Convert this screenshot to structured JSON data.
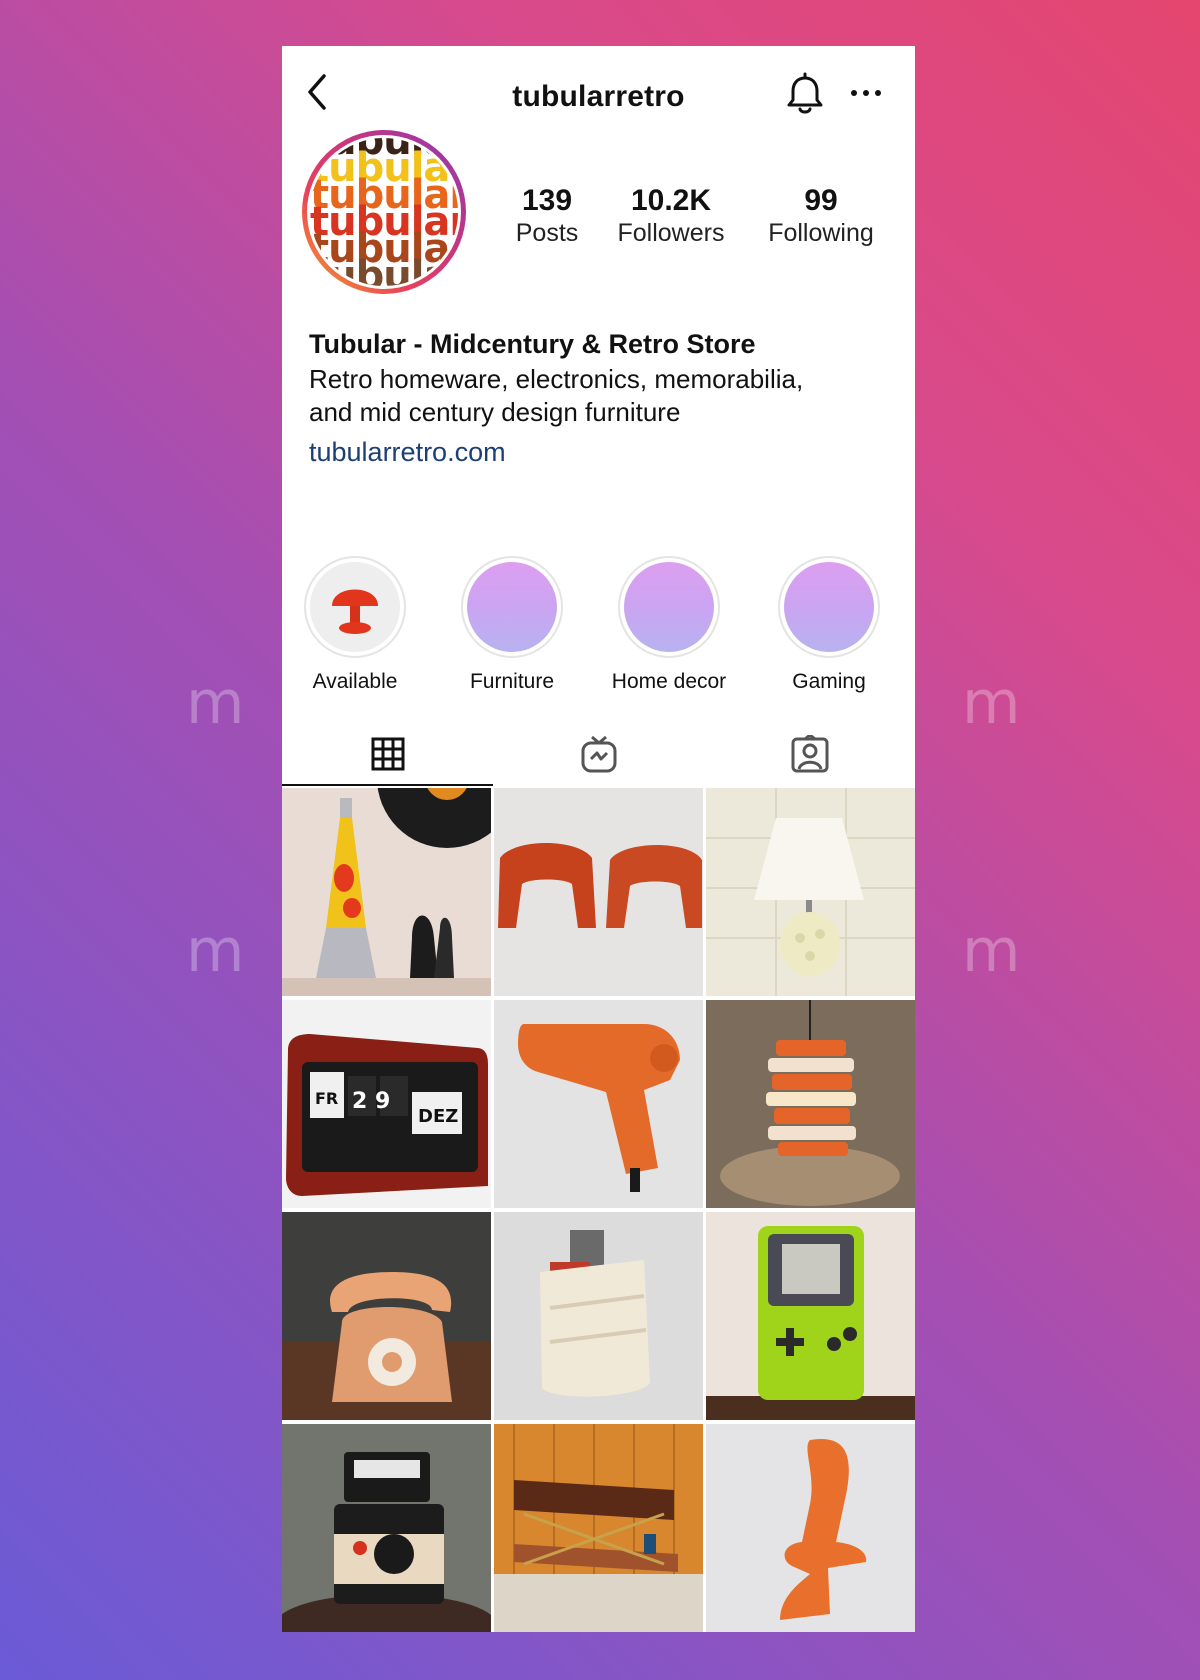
{
  "profile": {
    "username": "tubularretro",
    "avatar_words": [
      "tubular",
      "tubular",
      "tubular",
      "tubular",
      "tubular",
      "tubular",
      "tubular"
    ],
    "stats": [
      {
        "value": "139",
        "label": "Posts"
      },
      {
        "value": "10.2K",
        "label": "Followers"
      },
      {
        "value": "99",
        "label": "Following"
      }
    ],
    "display_name": "Tubular - Midcentury & Retro Store",
    "bio_line1": "Retro homeware, electronics, memorabilia,",
    "bio_line2": "and mid century design furniture",
    "website": "tubularretro.com"
  },
  "highlights": [
    {
      "label": "Available"
    },
    {
      "label": "Furniture"
    },
    {
      "label": "Home decor"
    },
    {
      "label": "Gaming"
    }
  ],
  "tabs": [
    "grid-icon",
    "igtv-icon",
    "tagged-icon"
  ],
  "posts": [
    {
      "subject": "lava lamp and vinyl record"
    },
    {
      "subject": "orange plastic stools"
    },
    {
      "subject": "ceramic table lamp"
    },
    {
      "subject": "flip clock",
      "clock_day": "FR",
      "clock_date": "2 9",
      "clock_month": "DEZ"
    },
    {
      "subject": "orange hair dryer"
    },
    {
      "subject": "orange pendant lamp"
    },
    {
      "subject": "orange rotary telephone"
    },
    {
      "subject": "magazine rack"
    },
    {
      "subject": "game boy color"
    },
    {
      "subject": "instant camera"
    },
    {
      "subject": "bar cart"
    },
    {
      "subject": "orange chair"
    }
  ],
  "colors": {
    "accent_link": "#1c3f75",
    "avatar_colors": [
      "#3a2418",
      "#f2c21b",
      "#e8661c",
      "#d8341f",
      "#a9461c",
      "#7a4a2c",
      "#1d7fb0"
    ]
  }
}
